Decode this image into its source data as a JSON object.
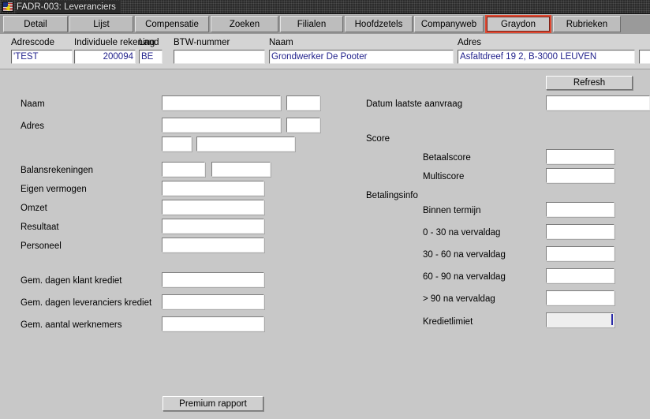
{
  "window": {
    "title": "FADR-003: Leveranciers",
    "icon": "app-flag-icon"
  },
  "tabs": [
    {
      "label": "Detail",
      "active": false
    },
    {
      "label": "Lijst",
      "active": false
    },
    {
      "label": "Compensatie",
      "active": false
    },
    {
      "label": "Zoeken",
      "active": false
    },
    {
      "label": "Filialen",
      "active": false
    },
    {
      "label": "Hoofdzetels",
      "active": false
    },
    {
      "label": "Companyweb",
      "active": false
    },
    {
      "label": "Graydon",
      "active": true
    },
    {
      "label": "Rubrieken",
      "active": false
    }
  ],
  "header": {
    "fields": [
      {
        "label": "Adrescode",
        "value": "'TEST",
        "align": "left"
      },
      {
        "label": "Individuele rekening",
        "value": "200094",
        "align": "right"
      },
      {
        "label": "Land",
        "value": "BE",
        "align": "left"
      },
      {
        "label": "BTW-nummer",
        "value": "",
        "align": "left"
      },
      {
        "label": "Naam",
        "value": "Grondwerker De Pooter",
        "align": "left"
      },
      {
        "label": "Adres",
        "value": "Asfaltdreef 19 2, B-3000 LEUVEN",
        "align": "left"
      },
      {
        "label": "",
        "value": "",
        "align": "left"
      }
    ]
  },
  "toolbar": {
    "refresh_label": "Refresh"
  },
  "left_panel": {
    "rows": [
      {
        "label": "Naam",
        "value": "",
        "value2": ""
      },
      {
        "label": "Adres",
        "value": "",
        "value2": ""
      },
      {
        "label": "",
        "value": "",
        "value2": ""
      },
      {
        "label": "Balansrekeningen",
        "value": "",
        "value2": ""
      },
      {
        "label": "Eigen vermogen",
        "value": ""
      },
      {
        "label": "Omzet",
        "value": ""
      },
      {
        "label": "Resultaat",
        "value": ""
      },
      {
        "label": "Personeel",
        "value": ""
      },
      {
        "label": "Gem. dagen klant krediet",
        "value": ""
      },
      {
        "label": "Gem. dagen leveranciers krediet",
        "value": ""
      },
      {
        "label": "Gem. aantal werknemers",
        "value": ""
      }
    ]
  },
  "right_panel": {
    "datum_label": "Datum laatste aanvraag",
    "datum_value": "",
    "score_group_label": "Score",
    "score_rows": [
      {
        "label": "Betaalscore",
        "value": ""
      },
      {
        "label": "Multiscore",
        "value": ""
      }
    ],
    "betalingsinfo_group_label": "Betalingsinfo",
    "betalingsinfo_rows": [
      {
        "label": "Binnen termijn",
        "value": ""
      },
      {
        "label": "0 - 30 na vervaldag",
        "value": ""
      },
      {
        "label": "30 - 60 na vervaldag",
        "value": ""
      },
      {
        "label": "60 - 90 na vervaldag",
        "value": ""
      },
      {
        "label": "> 90 na vervaldag",
        "value": ""
      }
    ],
    "kredietlimiet_label": "Kredietlimiet",
    "kredietlimiet_value": ""
  },
  "footer": {
    "premium_label": "Premium rapport"
  },
  "colors": {
    "window_bg": "#c8c8c8",
    "header_bg": "#d4d4d4",
    "titlebar_bg": "#2b2b2b",
    "tabstrip_bg": "#9a9a9a",
    "tab_bg": "#bdbdbd",
    "active_tab_border": "#e04a33",
    "field_text": "#22228c",
    "disabled_field_bg": "#eeeeee",
    "caret": "#2a2aa8"
  }
}
